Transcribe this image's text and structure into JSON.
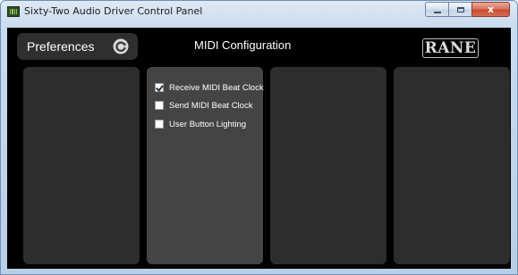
{
  "window": {
    "title": "Sixty-Two Audio Driver Control Panel",
    "close_glyph": "x"
  },
  "header": {
    "preferences_label": "Preferences",
    "page_title": "MIDI Configuration",
    "logo_text": "RANE"
  },
  "midi_options": [
    {
      "label": "Receive MIDI Beat Clock",
      "checked": true
    },
    {
      "label": "Send MIDI Beat Clock",
      "checked": false
    },
    {
      "label": "User Button Lighting",
      "checked": false
    }
  ],
  "icons": {
    "app": "audio-device-icon",
    "refresh": "refresh-icon",
    "minimize": "minimize-icon",
    "maximize": "maximize-icon",
    "close": "close-icon"
  },
  "colors": {
    "client_background": "#000000",
    "panel": "#2d2d2d",
    "active_panel": "#444444",
    "text": "#ffffff"
  }
}
